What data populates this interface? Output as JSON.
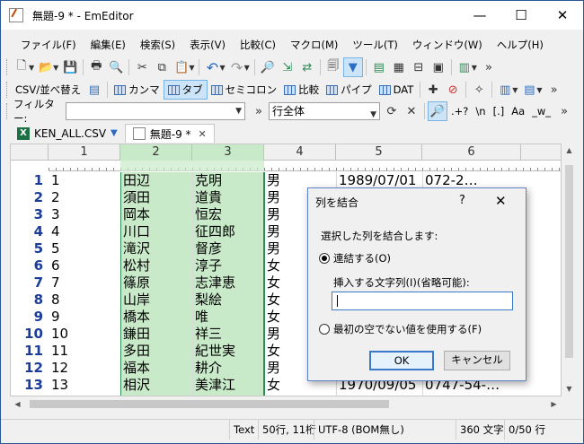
{
  "window": {
    "title": "無題-9 * - EmEditor"
  },
  "titlebar_buttons": [
    "—",
    "☐",
    "✕"
  ],
  "menu": [
    "ファイル(F)",
    "編集(E)",
    "検索(S)",
    "表示(V)",
    "比較(C)",
    "マクロ(M)",
    "ツール(T)",
    "ウィンドウ(W)",
    "ヘルプ(H)"
  ],
  "csv_toolbar": {
    "sort_label": "CSV/並べ替え",
    "items": [
      "カンマ",
      "タブ",
      "セミコロン",
      "比較",
      "パイプ",
      "DAT"
    ],
    "active_item": "タブ"
  },
  "find_toolbar": {
    "filter_label": "フィルター:",
    "filter_value": "",
    "scope_value": "行全体",
    "regex_label": ".+?",
    "escape_label": "\\n",
    "bracket_label": "[.]",
    "case_label": "Aa",
    "word_label": "_w_"
  },
  "tabs": [
    {
      "label": "KEN_ALL.CSV",
      "active": false,
      "filtered": true
    },
    {
      "label": "無題-9 *",
      "active": true,
      "close": "✕"
    }
  ],
  "columns": [
    "1",
    "2",
    "3",
    "4",
    "5",
    "6"
  ],
  "selected_columns": [
    "2",
    "3"
  ],
  "rows": [
    {
      "n": "1",
      "c1": "1",
      "c2": "田辺",
      "c3": "克明",
      "c4": "男",
      "c5": "1989/07/01",
      "c6": "072-2…"
    },
    {
      "n": "2",
      "c1": "2",
      "c2": "須田",
      "c3": "道貴",
      "c4": "男",
      "c5": "",
      "c6": ""
    },
    {
      "n": "3",
      "c1": "3",
      "c2": "岡本",
      "c3": "恒宏",
      "c4": "男",
      "c5": "",
      "c6": ""
    },
    {
      "n": "4",
      "c1": "4",
      "c2": "川口",
      "c3": "征四郎",
      "c4": "男",
      "c5": "",
      "c6": ""
    },
    {
      "n": "5",
      "c1": "5",
      "c2": "滝沢",
      "c3": "督彦",
      "c4": "男",
      "c5": "",
      "c6": ""
    },
    {
      "n": "6",
      "c1": "6",
      "c2": "松村",
      "c3": "淳子",
      "c4": "女",
      "c5": "",
      "c6": ""
    },
    {
      "n": "7",
      "c1": "7",
      "c2": "篠原",
      "c3": "志津恵",
      "c4": "女",
      "c5": "",
      "c6": ""
    },
    {
      "n": "8",
      "c1": "8",
      "c2": "山岸",
      "c3": "梨絵",
      "c4": "女",
      "c5": "",
      "c6": ""
    },
    {
      "n": "9",
      "c1": "9",
      "c2": "橋本",
      "c3": "唯",
      "c4": "女",
      "c5": "",
      "c6": ""
    },
    {
      "n": "10",
      "c1": "10",
      "c2": "鎌田",
      "c3": "祥三",
      "c4": "男",
      "c5": "",
      "c6": ""
    },
    {
      "n": "11",
      "c1": "11",
      "c2": "多田",
      "c3": "紀世実",
      "c4": "女",
      "c5": "",
      "c6": ""
    },
    {
      "n": "12",
      "c1": "12",
      "c2": "福本",
      "c3": "耕介",
      "c4": "男",
      "c5": "",
      "c6": ""
    },
    {
      "n": "13",
      "c1": "13",
      "c2": "相沢",
      "c3": "美津江",
      "c4": "女",
      "c5": "1970/09/05",
      "c6": "0747-54-…"
    }
  ],
  "status": {
    "mode": "Text",
    "position": "50行, 11桁",
    "encoding": "UTF-8 (BOM無し)",
    "chars": "360 文字",
    "lines": "0/50 行"
  },
  "dialog": {
    "title": "列を結合",
    "help": "?",
    "close": "✕",
    "description": "選択した列を結合します:",
    "option_concat": "連結する(O)",
    "insert_label": "挿入する文字列(I)(省略可能):",
    "insert_value": "",
    "option_first_nonempty": "最初の空でない値を使用する(F)",
    "ok": "OK",
    "cancel": "キャンセル",
    "selected_option": "concat"
  }
}
